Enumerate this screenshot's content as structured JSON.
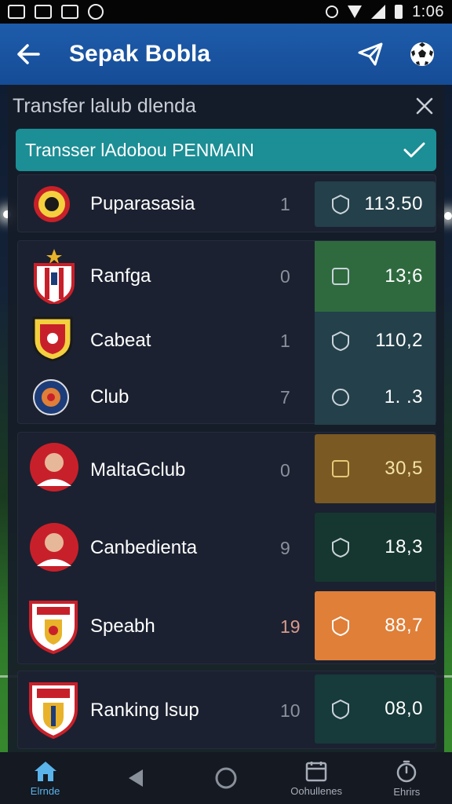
{
  "status_bar": {
    "time": "1:06"
  },
  "app_bar": {
    "title": "Sepak Bobla"
  },
  "panel": {
    "title": "Transfer lalub dlenda",
    "banner_label": "Transser lAdobou PENMAIN"
  },
  "clubs": [
    {
      "name": "Puparasasia",
      "rank": "1",
      "odds": "113.50",
      "color": "#24404a"
    },
    {
      "name": "Ranfga",
      "rank": "0",
      "odds": "13;6",
      "color": "#2f6a3f"
    },
    {
      "name": "Cabeat",
      "rank": "1",
      "odds": "110,2",
      "color": "#24404a"
    },
    {
      "name": "Club",
      "rank": "7",
      "odds": "1. .3",
      "color": "#24404a"
    },
    {
      "name": "MaltaGclub",
      "rank": "0",
      "odds": "30,5",
      "color": "#7a5a22"
    },
    {
      "name": "Canbedienta",
      "rank": "9",
      "odds": "18,3",
      "color": "#15372f"
    },
    {
      "name": "Speabh",
      "rank": "19",
      "odds": "88,7",
      "color": "#e07f38"
    },
    {
      "name": "Ranking lsup",
      "rank": "10",
      "odds": "08,0",
      "color": "#173a3a"
    }
  ],
  "bottom_nav": {
    "items": [
      {
        "label": "Elrnde",
        "icon": "home-icon"
      },
      {
        "label": "",
        "icon": "back-triangle-icon"
      },
      {
        "label": "",
        "icon": "home-circle-icon"
      },
      {
        "label": "Oohullenes",
        "icon": "calendar-icon"
      },
      {
        "label": "Ehrirs",
        "icon": "stopwatch-icon"
      }
    ]
  }
}
